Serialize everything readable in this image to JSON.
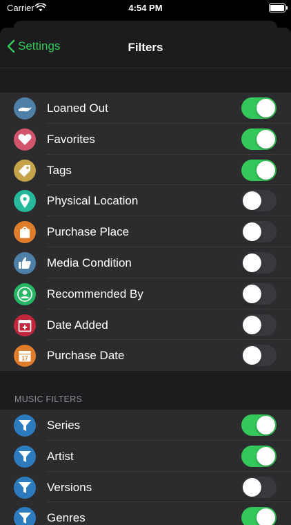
{
  "status": {
    "carrier": "Carrier",
    "time": "4:54 PM"
  },
  "nav": {
    "back_label": "Settings",
    "title": "Filters"
  },
  "colors": {
    "accent": "#34c759",
    "background": "#1c1c1e",
    "cell": "#2c2c2e",
    "toggle_off": "#39393d"
  },
  "general_filters": [
    {
      "label": "Loaned Out",
      "icon": "hand-icon",
      "icon_color": "#4e7fa6",
      "on": true
    },
    {
      "label": "Favorites",
      "icon": "heart-icon",
      "icon_color": "#d2556d",
      "on": true
    },
    {
      "label": "Tags",
      "icon": "tag-icon",
      "icon_color": "#c5a349",
      "on": true
    },
    {
      "label": "Physical Location",
      "icon": "location-pin-icon",
      "icon_color": "#25b89a",
      "on": false
    },
    {
      "label": "Purchase Place",
      "icon": "shopping-bag-icon",
      "icon_color": "#e07d2b",
      "on": false
    },
    {
      "label": "Media Condition",
      "icon": "thumbs-up-icon",
      "icon_color": "#4e7fa6",
      "on": false
    },
    {
      "label": "Recommended By",
      "icon": "person-icon",
      "icon_color": "#27b566",
      "on": false
    },
    {
      "label": "Date Added",
      "icon": "calendar-add-icon",
      "icon_color": "#c0263c",
      "on": false
    },
    {
      "label": "Purchase Date",
      "icon": "calendar-icon",
      "icon_color": "#e07d2b",
      "on": false
    }
  ],
  "music_section": {
    "header": "MUSIC FILTERS",
    "filters": [
      {
        "label": "Series",
        "icon": "filter-funnel-icon",
        "icon_color": "#2c7bbf",
        "on": true
      },
      {
        "label": "Artist",
        "icon": "filter-funnel-icon",
        "icon_color": "#2c7bbf",
        "on": true
      },
      {
        "label": "Versions",
        "icon": "filter-funnel-icon",
        "icon_color": "#2c7bbf",
        "on": false
      },
      {
        "label": "Genres",
        "icon": "filter-funnel-icon",
        "icon_color": "#2c7bbf",
        "on": true
      }
    ]
  }
}
